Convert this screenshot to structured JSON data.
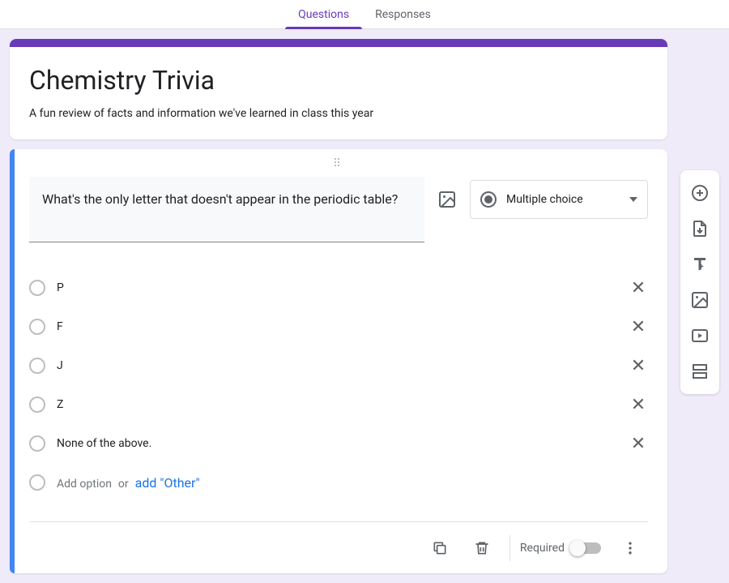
{
  "tabs": {
    "questions": "Questions",
    "responses": "Responses"
  },
  "header": {
    "title": "Chemistry Trivia",
    "description": "A fun review of facts and information we've learned in class this year"
  },
  "question": {
    "text": "What's the only letter that doesn't appear in the periodic table?",
    "type_label": "Multiple choice",
    "options": [
      "P",
      "F",
      "J",
      "Z",
      "None of the above."
    ],
    "add_option": "Add option",
    "or": "or",
    "add_other": "add \"Other\""
  },
  "footer": {
    "required_label": "Required"
  }
}
